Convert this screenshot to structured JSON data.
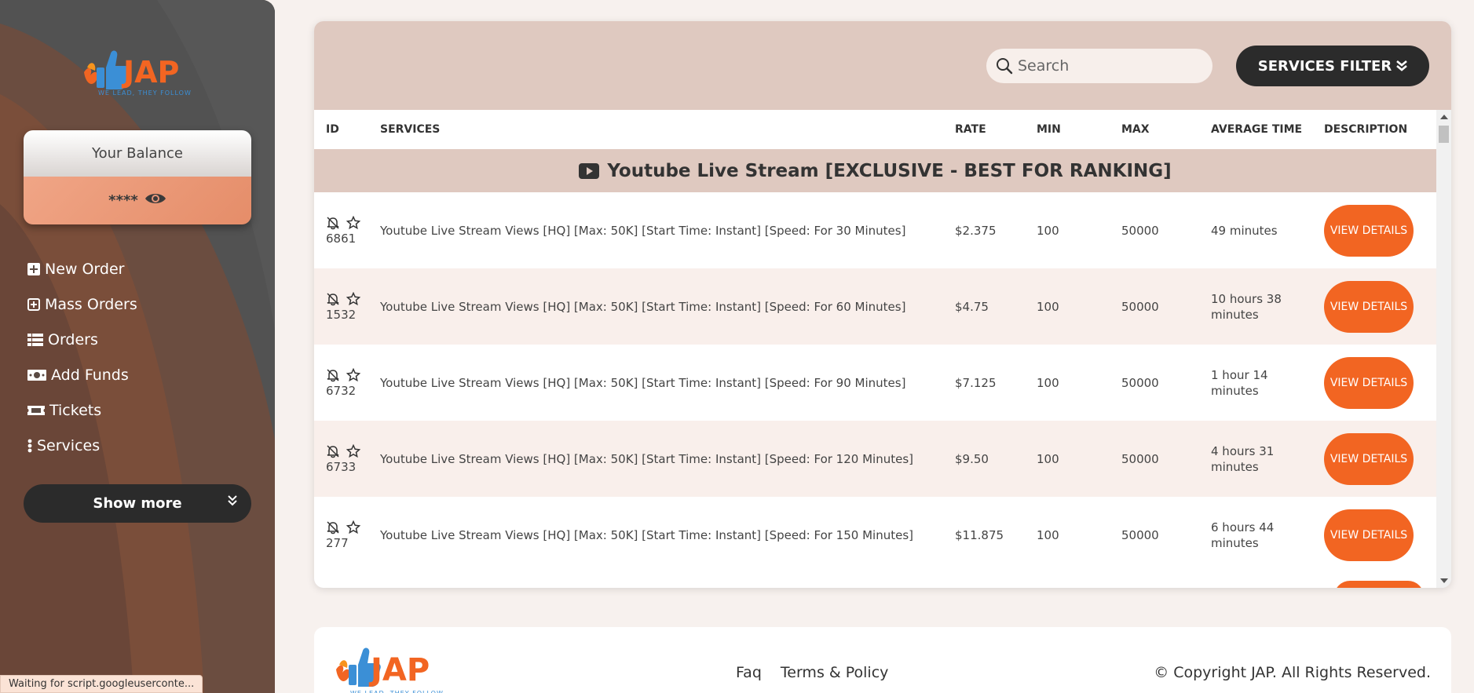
{
  "brand": {
    "logo_text": "JAP",
    "tagline": "WE LEAD, THEY FOLLOW"
  },
  "balance": {
    "label": "Your Balance",
    "value": "****"
  },
  "nav": {
    "items": [
      {
        "label": "New Order",
        "icon": "plus-square-icon"
      },
      {
        "label": "Mass Orders",
        "icon": "plus-square-outline-icon"
      },
      {
        "label": "Orders",
        "icon": "list-icon"
      },
      {
        "label": "Add Funds",
        "icon": "money-icon"
      },
      {
        "label": "Tickets",
        "icon": "ticket-icon"
      },
      {
        "label": "Services",
        "icon": "ellipsis-vertical-icon"
      }
    ],
    "show_more": "Show more"
  },
  "toolbar": {
    "search_placeholder": "Search",
    "filter_label": "SERVICES FILTER"
  },
  "table": {
    "headers": [
      "ID",
      "SERVICES",
      "RATE",
      "MIN",
      "MAX",
      "AVERAGE TIME",
      "DESCRIPTION"
    ],
    "category": "Youtube Live Stream [EXCLUSIVE - BEST FOR RANKING]",
    "view_label": "VIEW DETAILS",
    "rows": [
      {
        "id": "6861",
        "service": "Youtube Live Stream Views [HQ] [Max: 50K] [Start Time: Instant] [Speed: For 30 Minutes]",
        "rate": "$2.375",
        "min": "100",
        "max": "50000",
        "avg": "49 minutes"
      },
      {
        "id": "1532",
        "service": "Youtube Live Stream Views [HQ] [Max: 50K] [Start Time: Instant] [Speed: For 60 Minutes]",
        "rate": "$4.75",
        "min": "100",
        "max": "50000",
        "avg": "10 hours 38 minutes"
      },
      {
        "id": "6732",
        "service": "Youtube Live Stream Views [HQ] [Max: 50K] [Start Time: Instant] [Speed: For 90 Minutes]",
        "rate": "$7.125",
        "min": "100",
        "max": "50000",
        "avg": "1 hour 14 minutes"
      },
      {
        "id": "6733",
        "service": "Youtube Live Stream Views [HQ] [Max: 50K] [Start Time: Instant] [Speed: For 120 Minutes]",
        "rate": "$9.50",
        "min": "100",
        "max": "50000",
        "avg": "4 hours 31 minutes"
      },
      {
        "id": "277",
        "service": "Youtube Live Stream Views [HQ] [Max: 50K] [Start Time: Instant] [Speed: For 150 Minutes]",
        "rate": "$11.875",
        "min": "100",
        "max": "50000",
        "avg": "6 hours 44 minutes"
      }
    ]
  },
  "footer": {
    "links": [
      "Faq",
      "Terms & Policy"
    ],
    "copyright": "© Copyright JAP. All Rights Reserved."
  },
  "status_bar": "Waiting for script.googleuserconte...",
  "colors": {
    "accent": "#f26522",
    "dark_button": "#2b2b2b",
    "header_tint": "#dfc9c0",
    "row_alt": "#f9efeb",
    "logo_blue": "#3b8fd6"
  }
}
